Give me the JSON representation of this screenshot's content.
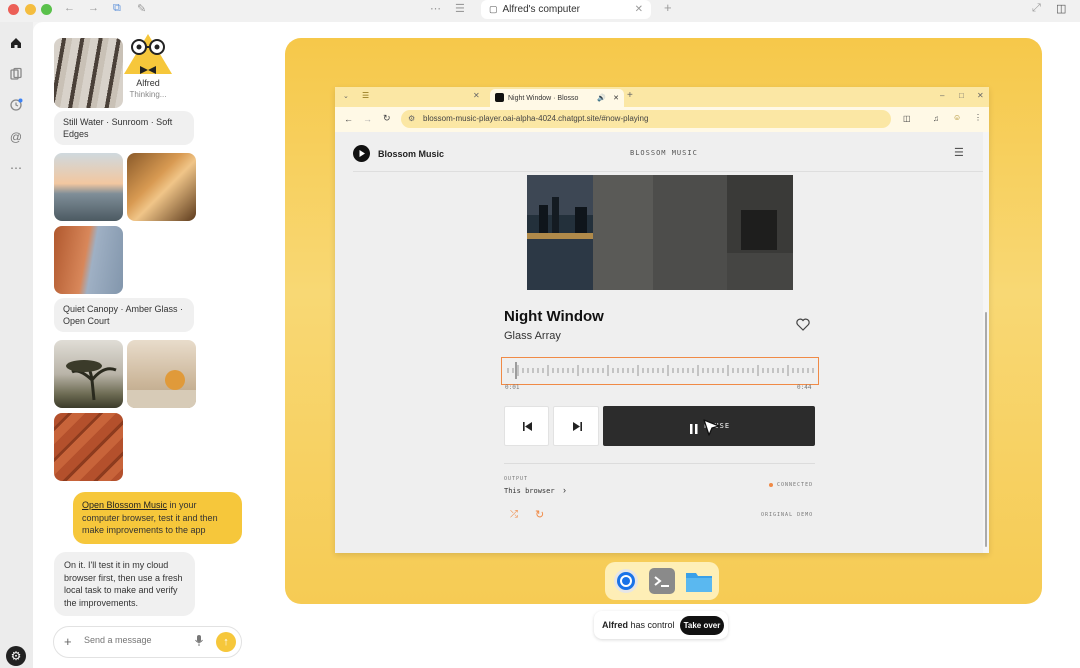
{
  "window": {
    "tab_title": "Alfred's computer"
  },
  "agent": {
    "name": "Alfred",
    "status": "Thinking..."
  },
  "chat": {
    "caption_1": "Still Water · Sunroom · Soft Edges",
    "caption_2": "Quiet Canopy · Amber Glass · Open Court",
    "user_message_link": "Open Blossom Music",
    "user_message_rest": " in your computer browser, test it and then make improvements to the app",
    "bot_message": "On it. I'll test it in my cloud browser first, then use a fresh local task to make and verify the improvements.",
    "input_placeholder": "Send a message"
  },
  "inner_browser": {
    "tab_title": "Night Window · Blosso",
    "url": "blossom-music-player.oai-alpha-4024.chatgpt.site/#now-playing"
  },
  "player": {
    "brand": "Blossom Music",
    "header_center": "BLOSSOM MUSIC",
    "track_title": "Night Window",
    "artist": "Glass Array",
    "time_elapsed": "0:01",
    "time_total": "0:44",
    "pause_label": "PAUSE",
    "output_label": "OUTPUT",
    "output_device": "This browser",
    "connection_status": "CONNECTED",
    "footer_tag": "ORIGINAL DEMO"
  },
  "control": {
    "agent_name": "Alfred",
    "text": "has control",
    "take_over_label": "Take over"
  },
  "colors": {
    "accent_yellow": "#f6c73b",
    "wave_border": "#f08a46",
    "status_dot": "#f08a46"
  }
}
